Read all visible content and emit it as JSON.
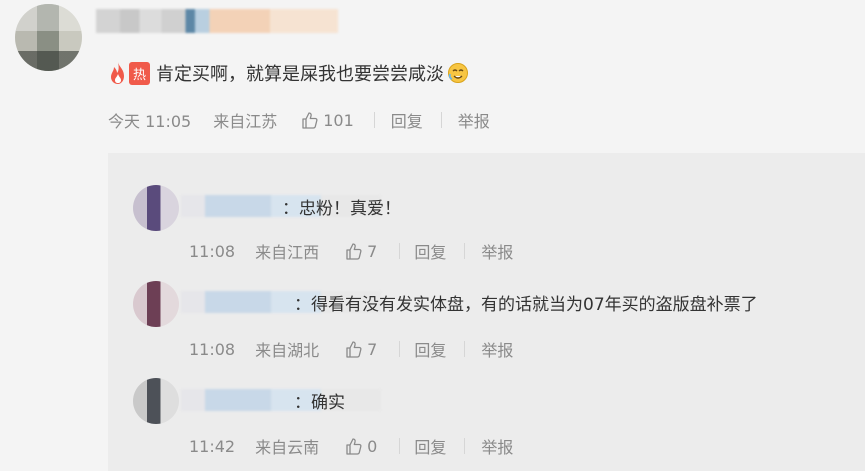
{
  "main": {
    "hot_label": "热",
    "text": "肯定买啊，就算是屎我也要尝尝咸淡",
    "time": "今天 11:05",
    "location": "来自江苏",
    "likes": "101",
    "reply_label": "回复",
    "report_label": "举报"
  },
  "replies": [
    {
      "text": "：忠粉！真爱！",
      "time": "11:08",
      "location": "来自江西",
      "likes": "7",
      "reply_label": "回复",
      "report_label": "举报"
    },
    {
      "text": "：得看有没有发实体盘，有的话就当为07年买的盗版盘补票了",
      "time": "11:08",
      "location": "来自湖北",
      "likes": "7",
      "reply_label": "回复",
      "report_label": "举报"
    },
    {
      "text": "：确实",
      "time": "11:42",
      "location": "来自云南",
      "likes": "0",
      "reply_label": "回复",
      "report_label": "举报"
    }
  ],
  "colors": {
    "hot": "#f05a4a",
    "meta": "#8a8a8a",
    "reply_bg": "#ececec",
    "page_bg": "#f4f4f4"
  },
  "icons": [
    "flame-icon",
    "emoji-icon",
    "thumbs-up-icon"
  ]
}
